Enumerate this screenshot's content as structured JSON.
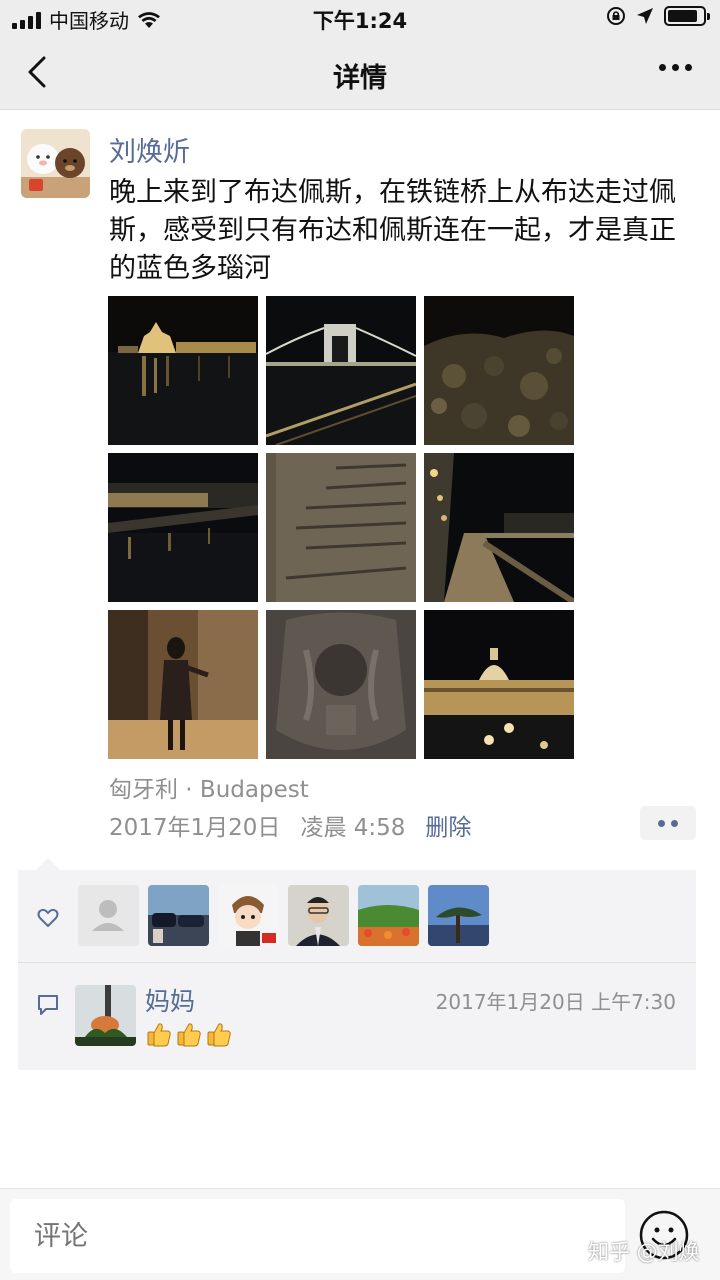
{
  "status_bar": {
    "carrier": "中国移动",
    "time": "下午1:24",
    "battery_level": 0.85
  },
  "nav": {
    "title": "详情",
    "back_icon": "chevron-left-icon",
    "more_icon": "more-horizontal-icon"
  },
  "post": {
    "author": "刘焕炘",
    "content": "晚上来到了布达佩斯，在铁链桥上从布达走过佩斯，感受到只有布达和佩斯连在一起，才是真正的蓝色多瑙河",
    "location": "匈牙利 · Budapest",
    "date": "2017年1月20日",
    "time": "凌晨 4:58",
    "delete_label": "删除",
    "photos": [
      {
        "name": "photo-parliament-night"
      },
      {
        "name": "photo-chain-bridge"
      },
      {
        "name": "photo-rock-closeup"
      },
      {
        "name": "photo-riverbank-night"
      },
      {
        "name": "photo-stone-inscription"
      },
      {
        "name": "photo-bridge-walkway"
      },
      {
        "name": "photo-woman-by-wall"
      },
      {
        "name": "photo-bronze-relief"
      },
      {
        "name": "photo-buda-castle"
      }
    ]
  },
  "likes": {
    "icon": "heart-icon",
    "users": [
      "liker-default",
      "liker-cars",
      "liker-cartoon",
      "liker-man",
      "liker-field",
      "liker-tree"
    ]
  },
  "comments": [
    {
      "author": "妈妈",
      "time": "2017年1月20日 上午7:30",
      "thumbs_up_count": 3
    }
  ],
  "input": {
    "placeholder": "评论",
    "emoji_icon": "emoji-icon"
  },
  "watermark": "知乎 @刘焕"
}
